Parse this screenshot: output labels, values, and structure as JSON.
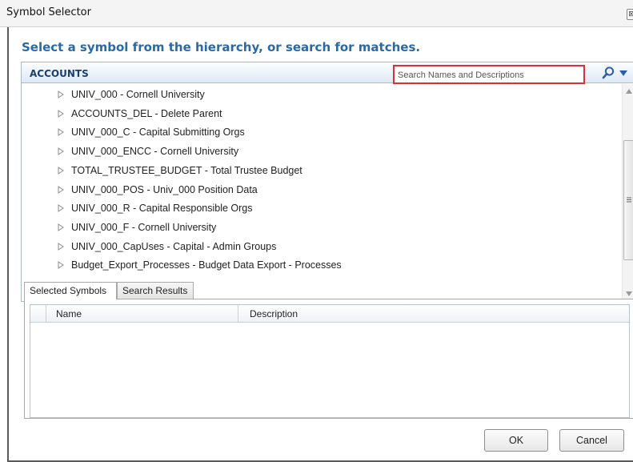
{
  "window": {
    "title": "Symbol Selector",
    "close_glyph": "⊠"
  },
  "heading": "Select a symbol from the hierarchy, or search for matches.",
  "tree": {
    "header_label": "ACCOUNTS",
    "search_placeholder": "Search Names and Descriptions",
    "search_value": "",
    "items": [
      {
        "label": "UNIV_000 - Cornell University"
      },
      {
        "label": "ACCOUNTS_DEL - Delete Parent"
      },
      {
        "label": "UNIV_000_C - Capital Submitting Orgs"
      },
      {
        "label": "UNIV_000_ENCC - Cornell University"
      },
      {
        "label": "TOTAL_TRUSTEE_BUDGET - Total Trustee Budget"
      },
      {
        "label": "UNIV_000_POS - Univ_000 Position Data"
      },
      {
        "label": "UNIV_000_R - Capital Responsible Orgs"
      },
      {
        "label": "UNIV_000_F - Cornell University"
      },
      {
        "label": "UNIV_000_CapUses - Capital - Admin Groups"
      },
      {
        "label": "Budget_Export_Processes - Budget Data Export - Processes"
      }
    ]
  },
  "tabs": [
    {
      "label": "Selected Symbols",
      "active": true
    },
    {
      "label": "Search Results",
      "active": false
    }
  ],
  "grid": {
    "columns": [
      "Name",
      "Description"
    ],
    "rows": []
  },
  "buttons": {
    "ok": "OK",
    "cancel": "Cancel"
  },
  "icons": {
    "search": "magnifier-icon",
    "dropdown": "triangle-down-icon",
    "tree_expand": "triangle-right-icon",
    "scroll_grip": "grip-icon"
  },
  "colors": {
    "heading": "#2a6aa4",
    "search_highlight": "#d83232",
    "header_text": "#1d3f6b",
    "search_icon": "#2a5fa8"
  }
}
